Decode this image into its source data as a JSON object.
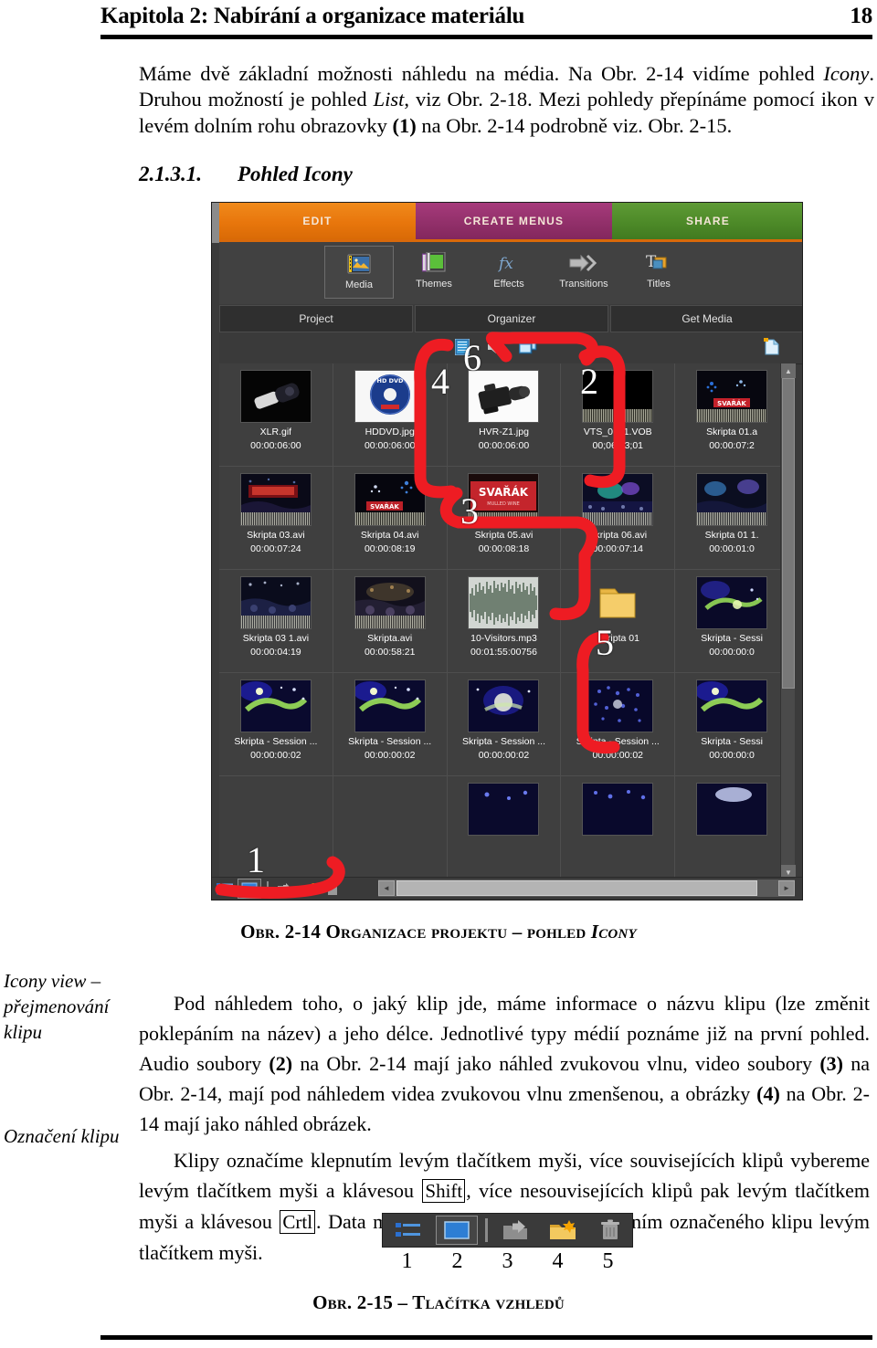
{
  "header": {
    "chapter_title": "Kapitola 2: Nabírání a organizace materiálu",
    "page_number": "18"
  },
  "intro": {
    "p1_a": "Máme dvě základní možnosti náhledu na média. Na Obr. 2-14 vidíme pohled ",
    "p1_icony": "Icony",
    "p1_b": ". Druhou možností je pohled ",
    "p1_list": "List",
    "p1_c": ", viz Obr. 2-18. Mezi pohledy přepínáme pomocí ikon v levém dolním rohu obrazovky ",
    "p1_one": "(1)",
    "p1_d": " na Obr. 2-14 podrobně viz. Obr. 2-15."
  },
  "section": {
    "number": "2.1.3.1.",
    "title": "Pohled Icony"
  },
  "app": {
    "mode_tabs": [
      {
        "label": "EDIT",
        "color": "#e8760c"
      },
      {
        "label": "CREATE MENUS",
        "color": "#92306a"
      },
      {
        "label": "SHARE",
        "color": "#4d8a28"
      }
    ],
    "tools": [
      {
        "label": "Media",
        "icon": "media-icon",
        "selected": true
      },
      {
        "label": "Themes",
        "icon": "themes-icon",
        "selected": false
      },
      {
        "label": "Effects",
        "icon": "effects-fx-icon",
        "selected": false
      },
      {
        "label": "Transitions",
        "icon": "transitions-arrow-icon",
        "selected": false
      },
      {
        "label": "Titles",
        "icon": "titles-icon",
        "selected": false
      }
    ],
    "sub_tabs": [
      {
        "label": "Project"
      },
      {
        "label": "Organizer"
      },
      {
        "label": "Get Media"
      }
    ],
    "filter_icons": [
      "video-filter-icon",
      "audio-filter-icon",
      "image-filter-icon"
    ],
    "new_item_icon": "new-item-icon",
    "grid_rows": [
      [
        {
          "name": "XLR.gif",
          "time": "00:00:06:00",
          "thumb": "xlr-connector",
          "wave": false
        },
        {
          "name": "HDDVD.jpg",
          "time": "00:00:06:00",
          "thumb": "hd-dvd-disc",
          "wave": false
        },
        {
          "name": "HVR-Z1.jpg",
          "time": "00:00:06:00",
          "thumb": "camcorder",
          "wave": false
        },
        {
          "name": "VTS_01_1.VOB",
          "time": "00;06;03;01",
          "thumb": "black-video",
          "wave": true
        },
        {
          "name": "Skripta 01.a",
          "time": "00:00:07:2",
          "thumb": "svarak-sign",
          "wave": true
        }
      ],
      [
        {
          "name": "Skripta 03.avi",
          "time": "00:00:07:24",
          "thumb": "night-crowd-red",
          "wave": true
        },
        {
          "name": "Skripta 04.avi",
          "time": "00:00:08:19",
          "thumb": "svarak-banner-dark",
          "wave": true
        },
        {
          "name": "Skripta 05.avi",
          "time": "00:00:08:18",
          "thumb": "svarak-banner-red",
          "wave": true
        },
        {
          "name": "Skripta 06.avi",
          "time": "00:00:07:14",
          "thumb": "stage-lights",
          "wave": true
        },
        {
          "name": "Skripta 01 1.",
          "time": "00:00:01:0",
          "thumb": "crowd-blue",
          "wave": true
        }
      ],
      [
        {
          "name": "Skripta 03 1.avi",
          "time": "00:00:04:19",
          "thumb": "crowd-night",
          "wave": true
        },
        {
          "name": "Skripta.avi",
          "time": "00:00:58:21",
          "thumb": "crowd-warm",
          "wave": true
        },
        {
          "name": "10-Visitors.mp3",
          "time": "00:01:55:00756",
          "thumb": "audio-waveform",
          "wave": false
        },
        {
          "name": "Skripta 01",
          "time": "",
          "thumb": "folder",
          "wave": false
        },
        {
          "name": "Skripta - Sessi",
          "time": "00:00:00:0",
          "thumb": "fireworks-green",
          "wave": false
        }
      ],
      [
        {
          "name": "Skripta - Session ...",
          "time": "00:00:00:02",
          "thumb": "fireworks-green",
          "wave": false
        },
        {
          "name": "Skripta - Session ...",
          "time": "00:00:00:02",
          "thumb": "fireworks-green",
          "wave": false
        },
        {
          "name": "Skripta - Session ...",
          "time": "00:00:00:02",
          "thumb": "fireworks-white",
          "wave": false
        },
        {
          "name": "Skripta - Session ...",
          "time": "00:00:00:02",
          "thumb": "fireworks-blue",
          "wave": false
        },
        {
          "name": "Skripta - Sessi",
          "time": "00:00:00:0",
          "thumb": "fireworks-green",
          "wave": false
        }
      ],
      [
        {
          "name": "",
          "time": "",
          "thumb": "empty",
          "wave": false
        },
        {
          "name": "",
          "time": "",
          "thumb": "empty",
          "wave": false
        },
        {
          "name": "",
          "time": "",
          "thumb": "fireworks-partial",
          "wave": false
        },
        {
          "name": "",
          "time": "",
          "thumb": "fireworks-partial-blue",
          "wave": false
        },
        {
          "name": "",
          "time": "",
          "thumb": "fireworks-partial-white",
          "wave": false
        }
      ]
    ],
    "annotations": [
      "1",
      "2",
      "3",
      "4",
      "5",
      "6"
    ],
    "annotation_color": "#ee1c23",
    "status_buttons": [
      "list-view-icon",
      "icon-view-icon",
      "open-project-icon",
      "add-media-folder-icon",
      "delete-icon"
    ]
  },
  "fig_2_14": {
    "prefix": "Obr. 2-14 Organizace projektu – pohled ",
    "italic": "Icony"
  },
  "margin_notes": [
    "Icony view – přejmenování klipu",
    "Označení klipu"
  ],
  "body": {
    "p1_a": "Pod náhledem toho, o jaký klip jde, máme informace o názvu klipu (lze změnit poklepáním na název) a jeho délce. Jednotlivé typy médií poznáme již na první pohled. Audio soubory ",
    "p1_two": "(2)",
    "p1_b": " na Obr. 2-14 mají jako náhled zvukovou vlnu, video soubory ",
    "p1_three": "(3)",
    "p1_c": " na Obr. 2-14, mají pod náhledem videa zvukovou vlnu zmenšenou, a obrázky ",
    "p1_four": "(4)",
    "p1_d": " na Obr. 2-14 mají jako náhled obrázek.",
    "p2_a": "Klipy označíme klepnutím levým tlačítkem myši, více souvisejících klipů vybereme levým tlačítkem myši a klávesou ",
    "p2_shift": "Shift",
    "p2_b": ", více nesouvisejících klipů pak levým tlačítkem myši a klávesou ",
    "p2_ctrl": "Crtl",
    "p2_c": ". Data můžeme srovnat a řadit přetažením označeného klipu levým tlačítkem myši."
  },
  "fig_2_15": {
    "caption": "Obr. 2-15 – Tlačítka vzhledů",
    "button_numbers": [
      "1",
      "2",
      "3",
      "4",
      "5"
    ],
    "buttons": [
      {
        "icon": "list-view-icon",
        "selected": false
      },
      {
        "icon": "icon-view-icon",
        "selected": true
      },
      {
        "icon": "open-project-icon",
        "selected": false
      },
      {
        "icon": "add-media-folder-icon",
        "selected": false
      },
      {
        "icon": "delete-trash-icon",
        "selected": false
      }
    ]
  }
}
